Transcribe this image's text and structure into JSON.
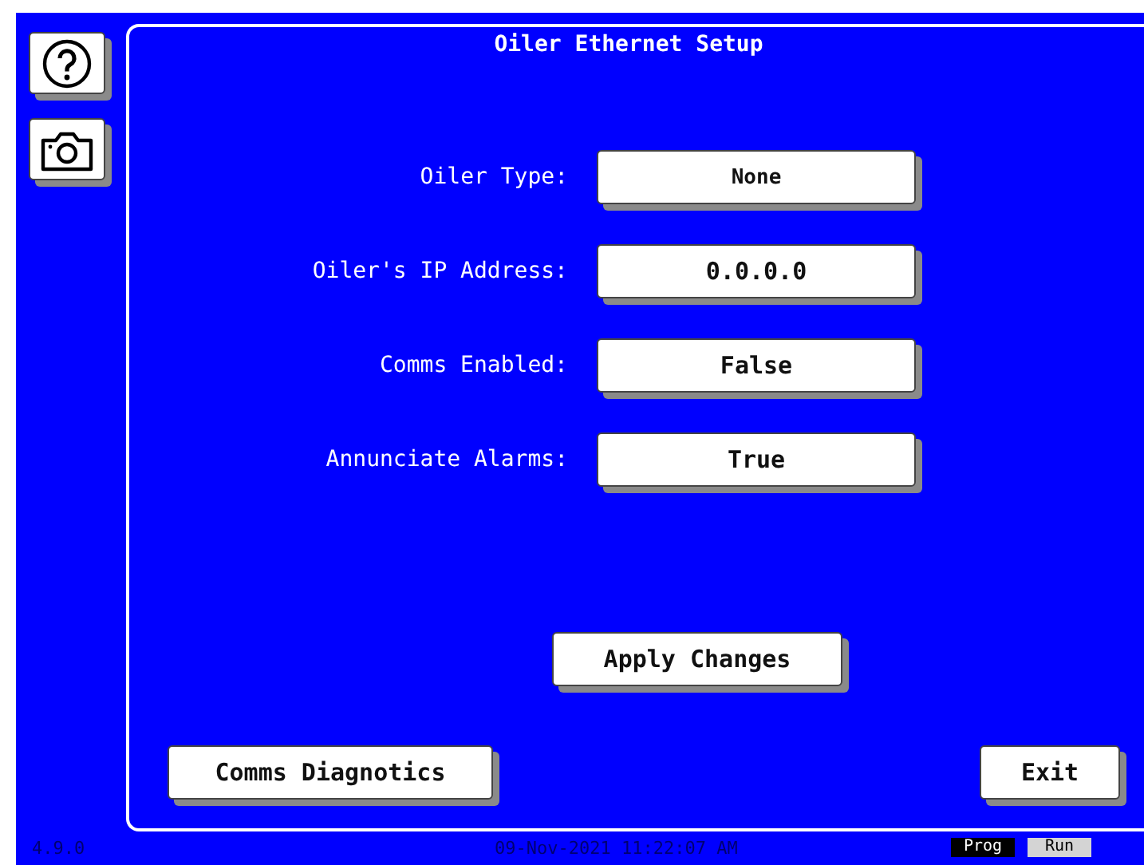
{
  "title": "Oiler Ethernet Setup",
  "settings": [
    {
      "label": "Oiler Type:",
      "value": "None"
    },
    {
      "label": "Oiler's IP Address:",
      "value": "0.0.0.0"
    },
    {
      "label": "Comms Enabled:",
      "value": "False"
    },
    {
      "label": "Annunciate Alarms:",
      "value": "True"
    }
  ],
  "apply_button": "Apply Changes",
  "diagnostics_button": "Comms Diagnotics",
  "exit_button": "Exit",
  "status_bar": {
    "version": "4.9.0",
    "datetime": "09-Nov-2021 11:22:07 AM",
    "modes": [
      {
        "label": "Prog",
        "selected": true
      },
      {
        "label": "Run",
        "selected": false
      }
    ]
  }
}
